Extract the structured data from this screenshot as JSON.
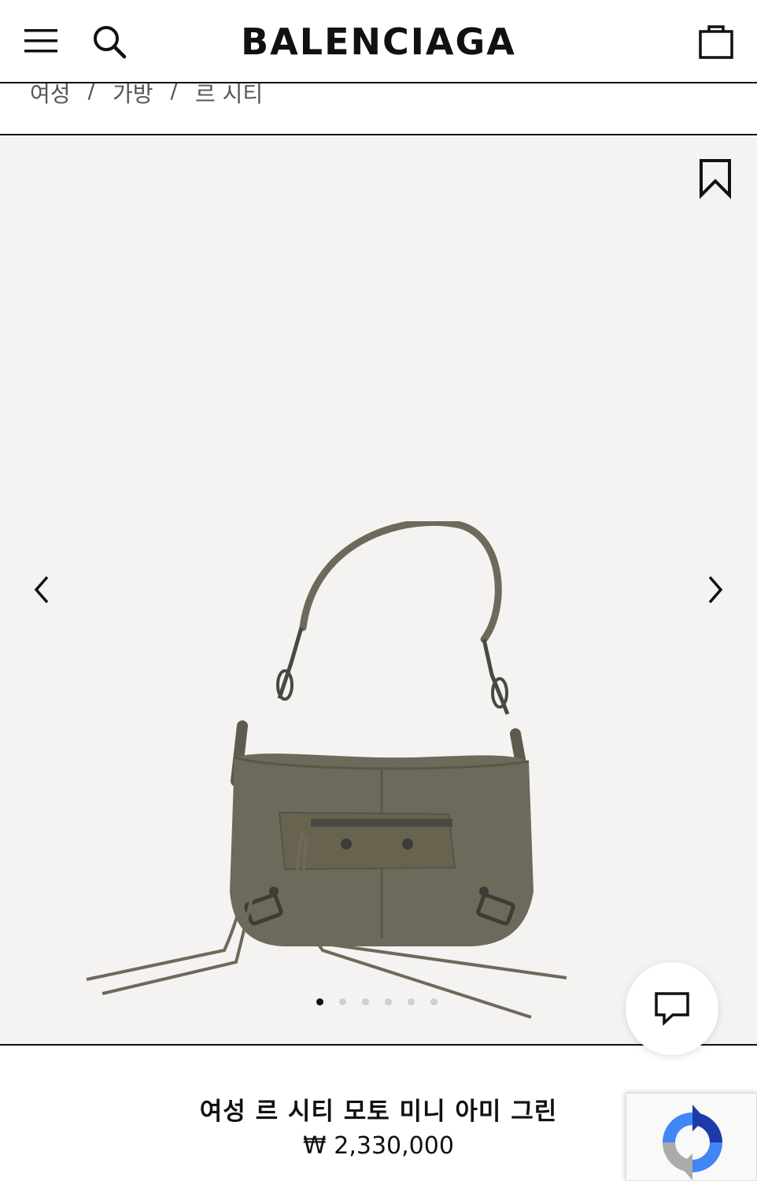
{
  "header": {
    "logo": "BALENCIAGA",
    "menu_icon": "hamburger-menu-icon",
    "search_icon": "search-icon",
    "cart_icon": "shopping-bag-icon"
  },
  "breadcrumb": {
    "items": [
      "여성",
      "가방",
      "르 시티"
    ],
    "separator": "/"
  },
  "gallery": {
    "wishlist_icon": "bookmark-icon",
    "prev_icon": "chevron-left-icon",
    "next_icon": "chevron-right-icon",
    "image_count": 6,
    "active_index": 0,
    "background": "#f4f3f2",
    "bag_color": "#6e6a5b"
  },
  "chat": {
    "icon": "chat-bubble-icon"
  },
  "product": {
    "title": "여성 르 시티 모토 미니 아미 그린",
    "price": "₩ 2,330,000"
  },
  "recaptcha": {
    "icon": "recaptcha-icon"
  }
}
